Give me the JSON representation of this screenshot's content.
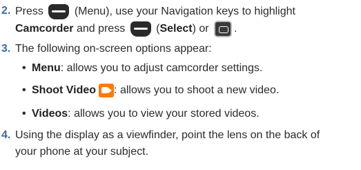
{
  "steps": [
    {
      "number": "2.",
      "line1_a": "Press",
      "line1_b": "(Menu), use your Navigation keys to highlight",
      "line2_bold": "Camcorder",
      "line2_a": "and press",
      "line2_b_open": "(",
      "line2_select": "Select",
      "line2_b_close": ") or",
      "line2_end": "."
    },
    {
      "number": "3.",
      "text": "The following on-screen options appear:"
    },
    {
      "number": "4.",
      "line1": "Using the display as a viewfinder, point the lens on the back of",
      "line2": "your phone at your subject."
    }
  ],
  "bullets": [
    {
      "term": "Menu",
      "desc": ": allows you to adjust camcorder settings."
    },
    {
      "term": "Shoot Video",
      "desc": ": allows you to shoot a new video.",
      "icon": "video-camera-icon"
    },
    {
      "term": "Videos",
      "desc": ": allows you to view your stored videos."
    }
  ],
  "colors": {
    "step_number": "#3a6aa5",
    "video_icon": "#ff7a00"
  }
}
